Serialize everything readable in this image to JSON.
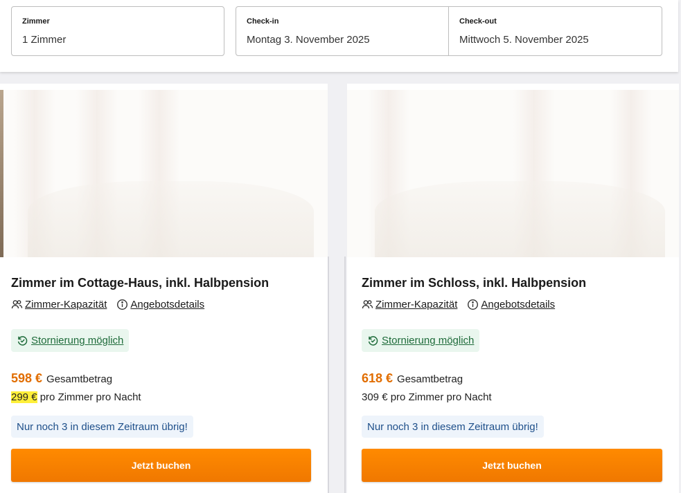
{
  "search": {
    "rooms": {
      "label": "Zimmer",
      "value": "1 Zimmer"
    },
    "checkin": {
      "label": "Check-in",
      "value": "Montag 3. November 2025"
    },
    "checkout": {
      "label": "Check-out",
      "value": "Mittwoch 5. November 2025"
    }
  },
  "offers": [
    {
      "title": "Zimmer im Cottage-Haus, inkl. Halbpension",
      "capacity_link": "Zimmer-Kapazität",
      "details_link": "Angebotsdetails",
      "cancellation": "Stornierung möglich",
      "total_price": "598 €",
      "total_label": "Gesamtbetrag",
      "night_price": "299 €",
      "night_label": "pro Zimmer pro Nacht",
      "scarcity": "Nur noch 3 in diesem Zeitraum übrig!",
      "book_label": "Jetzt buchen"
    },
    {
      "title": "Zimmer im Schloss, inkl. Halbpension",
      "capacity_link": "Zimmer-Kapazität",
      "details_link": "Angebotsdetails",
      "cancellation": "Stornierung möglich",
      "total_price": "618 €",
      "total_label": "Gesamtbetrag",
      "night_price": "309 €",
      "night_label": "pro Zimmer pro Nacht",
      "scarcity": "Nur noch 3 in diesem Zeitraum übrig!",
      "book_label": "Jetzt buchen"
    }
  ],
  "icons": {
    "capacity": "people-icon",
    "details": "info-icon",
    "cancellation": "refresh-check-icon"
  },
  "colors": {
    "price": "#e16d00",
    "book_button": "#ff8a00",
    "cancellation_bg": "#e9f6ee",
    "scarcity_bg": "#eef4fb",
    "highlight": "#ffef3a"
  }
}
